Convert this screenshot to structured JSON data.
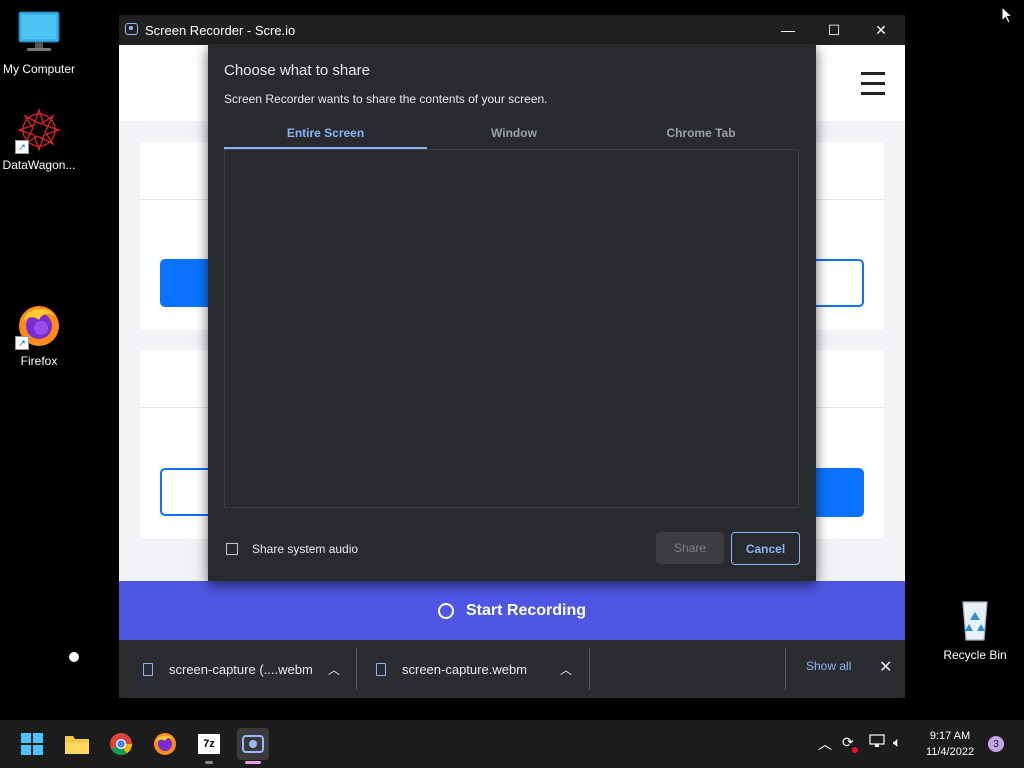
{
  "desktop": {
    "icons": [
      {
        "label": "My Computer",
        "icon": "monitor-icon"
      },
      {
        "label": "DataWagon...",
        "icon": "datawagon-icon"
      },
      {
        "label": "Firefox",
        "icon": "firefox-icon"
      },
      {
        "label": "Recycle Bin",
        "icon": "recycle-bin-icon"
      }
    ]
  },
  "window": {
    "title": "Screen Recorder - Scre.io",
    "controls": {
      "minimize": "—",
      "maximize": "☐",
      "close": "✕"
    }
  },
  "dialog": {
    "title": "Choose what to share",
    "subtitle": "Screen Recorder wants to share the contents of your screen.",
    "tabs": [
      {
        "label": "Entire Screen",
        "active": true
      },
      {
        "label": "Window",
        "active": false
      },
      {
        "label": "Chrome Tab",
        "active": false
      }
    ],
    "audio_label": "Share system audio",
    "audio_checked": false,
    "share_label": "Share",
    "cancel_label": "Cancel"
  },
  "record": {
    "label": "Start Recording"
  },
  "downloads": {
    "items": [
      {
        "name": "screen-capture (....webm"
      },
      {
        "name": "screen-capture.webm"
      }
    ],
    "show_all": "Show all",
    "close": "✕"
  },
  "taskbar": {
    "apps": [
      "windows-start-icon",
      "file-explorer-icon",
      "chrome-icon",
      "firefox-icon",
      "7zip-icon",
      "screen-recorder-icon"
    ],
    "time": "9:17 AM",
    "date": "11/4/2022",
    "notifications": "3"
  },
  "colors": {
    "accent_blue": "#0a72ff",
    "record_bar": "#4d57e3",
    "dialog_bg": "#292a2d",
    "dialog_accent": "#8ab4f8",
    "taskbar": "#1c1c1c"
  }
}
